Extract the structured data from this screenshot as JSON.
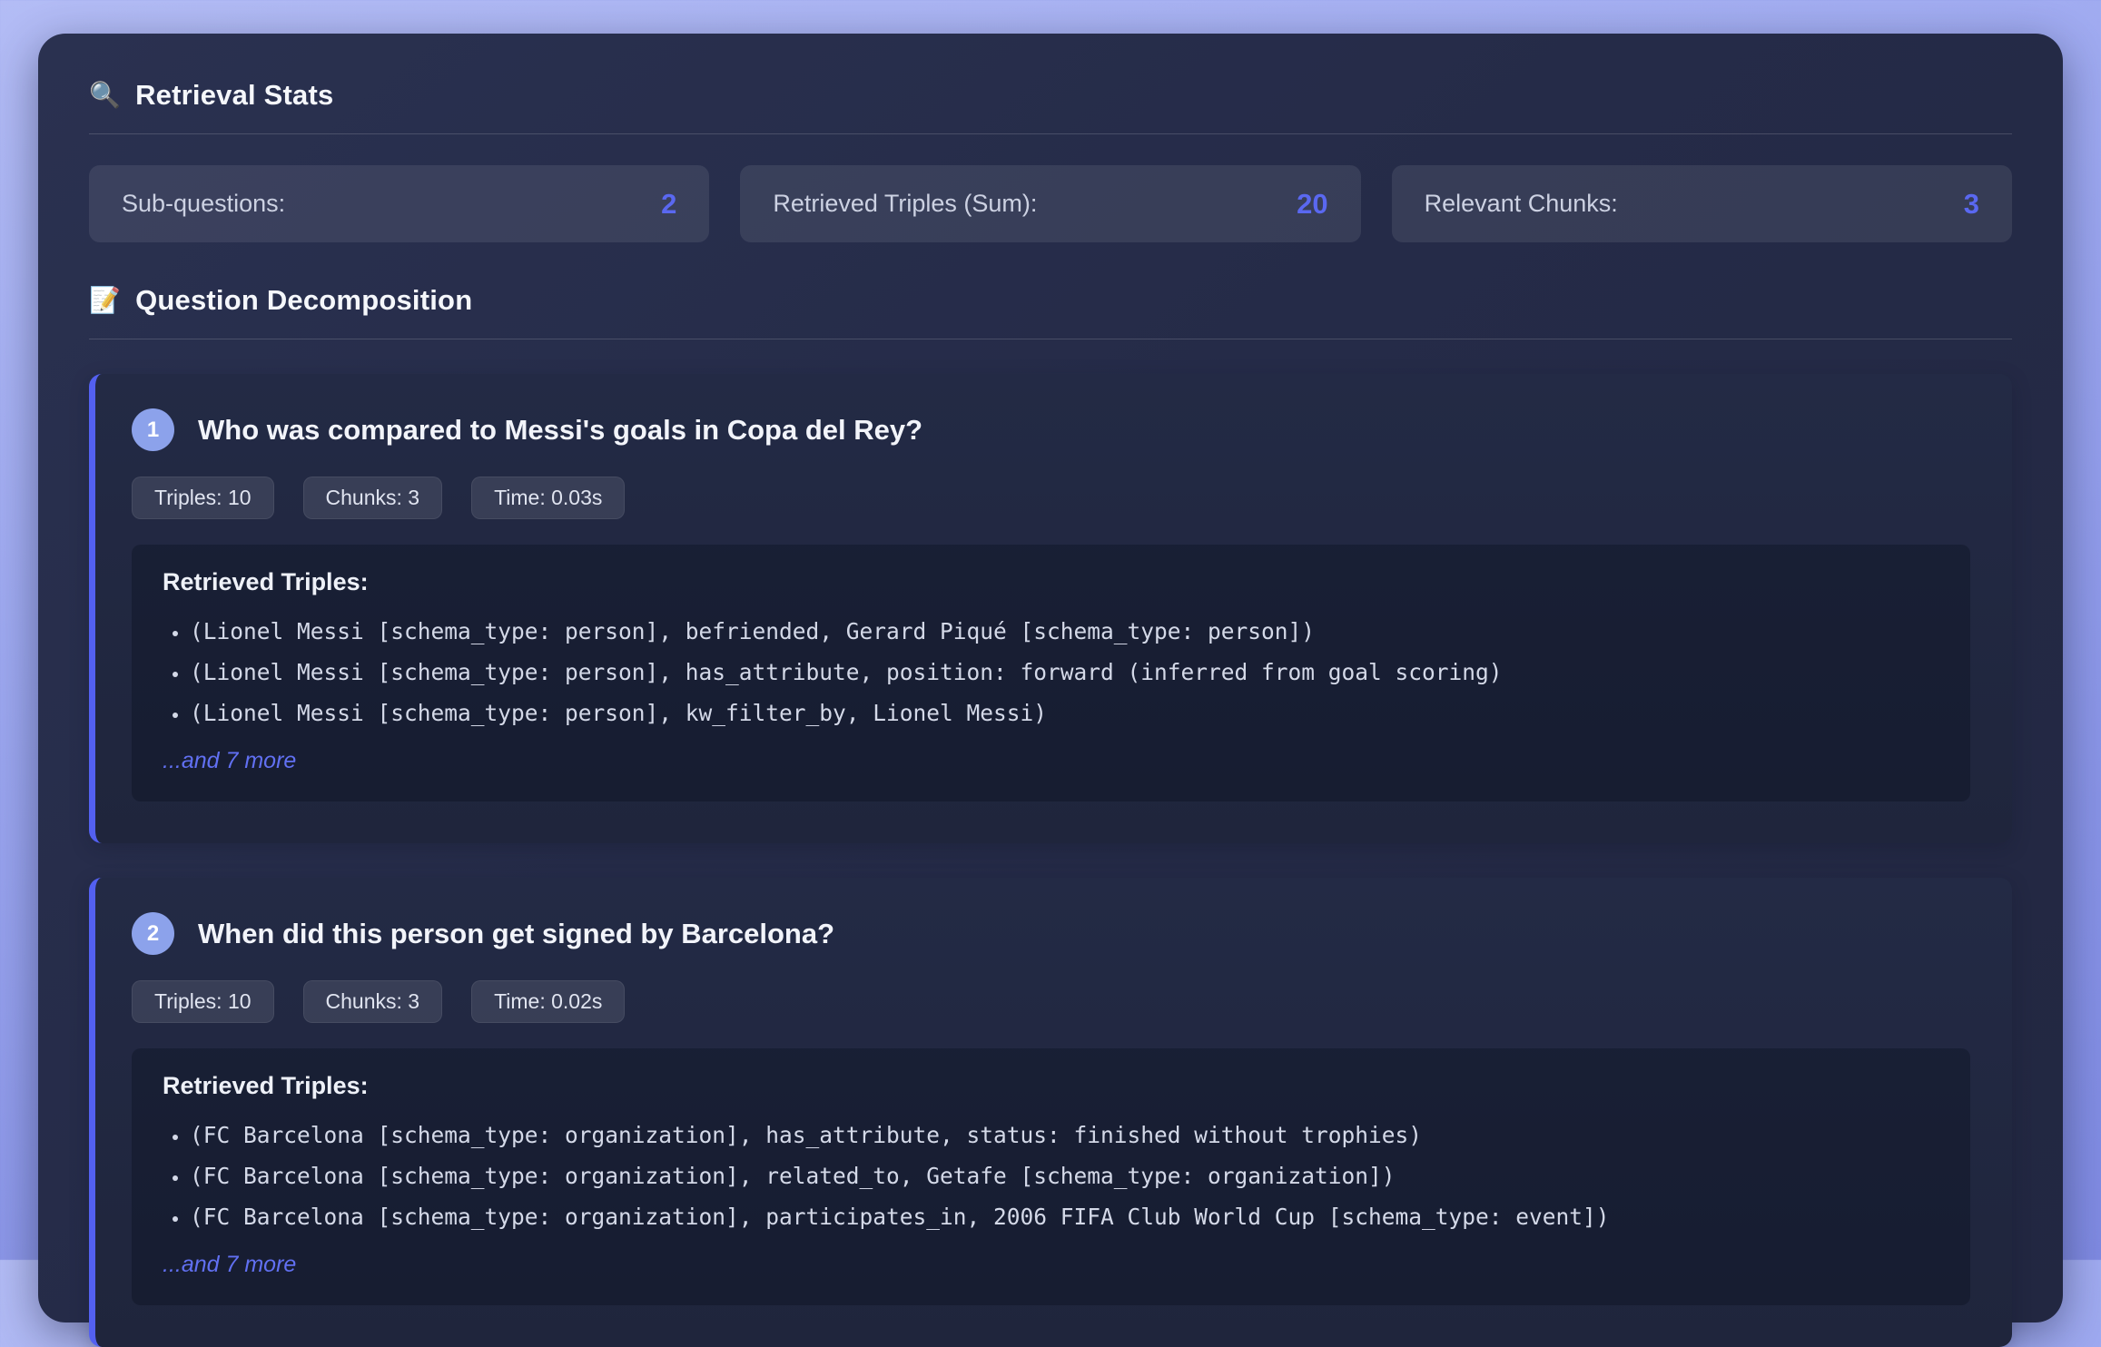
{
  "retrieval_stats": {
    "icon": "🔍",
    "title": "Retrieval Stats",
    "stats": [
      {
        "label": "Sub-questions:",
        "value": "2"
      },
      {
        "label": "Retrieved Triples (Sum):",
        "value": "20"
      },
      {
        "label": "Relevant Chunks:",
        "value": "3"
      }
    ]
  },
  "decomposition": {
    "icon": "📝",
    "title": "Question Decomposition",
    "questions": [
      {
        "number": "1",
        "question": "Who was compared to Messi's goals in Copa del Rey?",
        "badges": [
          "Triples: 10",
          "Chunks: 3",
          "Time: 0.03s"
        ],
        "triples_heading": "Retrieved Triples:",
        "triples": [
          "(Lionel Messi [schema_type: person], befriended, Gerard Piqué [schema_type: person])",
          "(Lionel Messi [schema_type: person], has_attribute, position: forward (inferred from goal scoring)",
          "(Lionel Messi [schema_type: person], kw_filter_by, Lionel Messi)"
        ],
        "more_label": "...and 7 more"
      },
      {
        "number": "2",
        "question": "When did this person get signed by Barcelona?",
        "badges": [
          "Triples: 10",
          "Chunks: 3",
          "Time: 0.02s"
        ],
        "triples_heading": "Retrieved Triples:",
        "triples": [
          "(FC Barcelona [schema_type: organization], has_attribute, status: finished without trophies)",
          "(FC Barcelona [schema_type: organization], related_to, Getafe [schema_type: organization])",
          "(FC Barcelona [schema_type: organization], participates_in, 2006 FIFA Club World Cup [schema_type: event])"
        ],
        "more_label": "...and 7 more"
      }
    ]
  },
  "colors": {
    "accent": "#5a68f0",
    "card_border": "#5360f0",
    "badge_circle": "#8ca2eb",
    "panel_bg": "#252b48",
    "outer_bg": "#9ea9f0"
  }
}
